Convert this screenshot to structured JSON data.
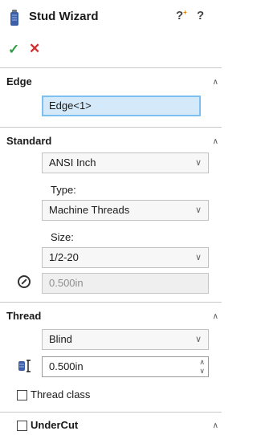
{
  "header": {
    "title": "Stud Wizard",
    "icon": "stud-icon",
    "help_icons": [
      "question-mark-plus-icon",
      "question-mark-icon"
    ]
  },
  "actions": {
    "ok_icon": "checkmark-icon",
    "cancel_icon": "x-icon"
  },
  "edge_section": {
    "title": "Edge",
    "selection_value": "Edge<1>"
  },
  "standard_section": {
    "title": "Standard",
    "standard_value": "ANSI Inch",
    "type_label": "Type:",
    "type_value": "Machine Threads",
    "size_label": "Size:",
    "size_value": "1/2-20",
    "diameter_value": "0.500in"
  },
  "thread_section": {
    "title": "Thread",
    "end_condition_value": "Blind",
    "depth_value": "0.500in",
    "thread_class_label": "Thread class"
  },
  "undercut_section": {
    "title": "UnderCut"
  },
  "colors": {
    "ok": "#2f9e44",
    "cancel": "#d32f2f",
    "selection_bg": "#d4e9f9",
    "selection_border": "#7cbff1"
  }
}
